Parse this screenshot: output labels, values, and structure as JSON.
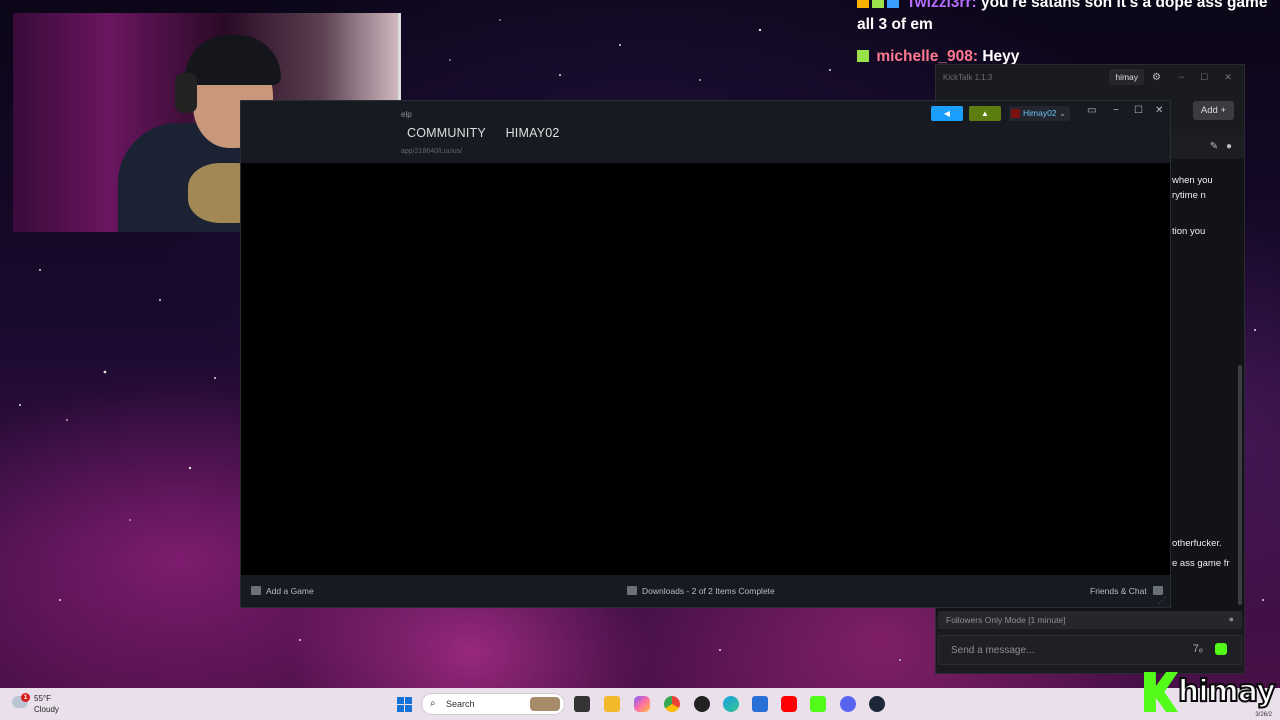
{
  "chat_overlay": {
    "messages": [
      {
        "user": "Twizzl3rr",
        "text": "you're satans son it's a dope ass game",
        "badges": [
          "square-badge",
          "sword-badge",
          "cube-badge"
        ]
      },
      {
        "user": "",
        "text": "all 3 of em",
        "badges": []
      },
      {
        "user": "michelle_908",
        "text": "Heyy",
        "badges": [
          "sword-badge"
        ]
      }
    ],
    "separator": ":"
  },
  "kicktalk": {
    "title": "KickTalk 1.1.3",
    "tab": "himay",
    "add_label": "Add",
    "messages": [
      "when you",
      "rytime n",
      "tion you",
      "otherfucker.",
      "e ass game fr"
    ],
    "followers_mode": "Followers Only Mode [1 minute]",
    "input_placeholder": "Send a message..."
  },
  "steam": {
    "menu_fragment": "elp",
    "nav": [
      "COMMUNITY",
      "HIMAY02"
    ],
    "url": "app/218640/Lucius/",
    "username": "Himay02",
    "add_game": "Add a Game",
    "downloads": "Downloads - 2 of 2 Items Complete",
    "friends": "Friends & Chat"
  },
  "taskbar": {
    "weather_temp": "55°F",
    "weather_desc": "Cloudy",
    "weather_alert": "1",
    "search_label": "Search",
    "apps": [
      "file-explorer-icon",
      "folder-icon",
      "copilot-icon",
      "chrome-icon",
      "obs-icon",
      "edge-icon",
      "store-icon",
      "youtube-icon",
      "kick-icon",
      "discord-icon",
      "steam-icon"
    ],
    "date_fragment": "3/26/2"
  },
  "overlay_brand": "himay",
  "colors": {
    "kick_green": "#53fc18",
    "steam_blue": "#1a9fff",
    "chat_user1": "#b56cff",
    "chat_user2": "#ff7a8f"
  }
}
